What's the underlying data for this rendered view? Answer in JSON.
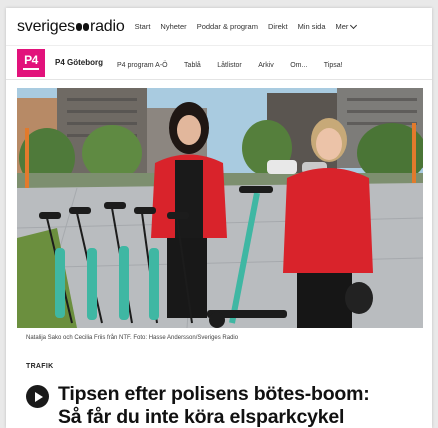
{
  "header": {
    "logo_prefix": "sveriges",
    "logo_suffix": "radio",
    "nav": [
      "Start",
      "Nyheter",
      "Poddar & program",
      "Direkt",
      "Min sida"
    ],
    "more_label": "Mer"
  },
  "channel": {
    "badge_text": "P4",
    "name": "P4 Göteborg",
    "nav": [
      "P4 program A-Ö",
      "Tablå",
      "Låtlistor",
      "Arkiv",
      "Om...",
      "Tipsa!"
    ]
  },
  "article": {
    "caption": "Natalija Sako och Cecilia Friis från NTF. Foto: Hasse Andersson/Sveriges Radio",
    "category": "TRAFIK",
    "headline_line1": "Tipsen efter polisens bötes-boom:",
    "headline_line2": "Så får du inte köra elsparkcykel"
  },
  "colors": {
    "p4_pink": "#e2127b",
    "jacket_red": "#d9232b",
    "scooter_teal": "#3fb7a3"
  }
}
